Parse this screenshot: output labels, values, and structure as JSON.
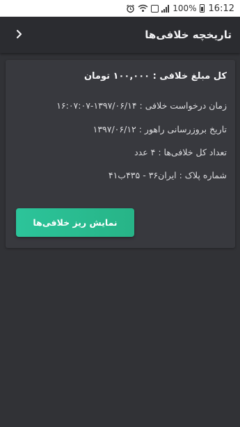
{
  "status_bar": {
    "battery": "100%",
    "time": "16:12",
    "icons": [
      "alarm-icon",
      "wifi-icon",
      "sim-icon",
      "signal-icon",
      "battery-icon"
    ]
  },
  "app_bar": {
    "title": "تاریخچه خلافی‌ها",
    "back_icon": "chevron-icon"
  },
  "summary": {
    "total": "کل مبلغ خلافی : ۱۰۰,۰۰۰ تومان",
    "request_time": "زمان درخواست خلافی : ۱۳۹۷/۰۶/۱۴-۱۶:۰۷:۰۷",
    "update_date": "تاریخ بروزرسانی راهور : ۱۳۹۷/۰۶/۱۲",
    "violation_count": "تعداد کل خلافی‌ها : ۴ عدد",
    "plate_number": "شماره پلاک : ایران۳۶ - ۴۳۵ب۴۱"
  },
  "actions": {
    "show_details": "نمایش ریز خلافی‌ها"
  },
  "colors": {
    "background": "#313236",
    "card": "#38393e",
    "accent": "#2cc49a"
  }
}
